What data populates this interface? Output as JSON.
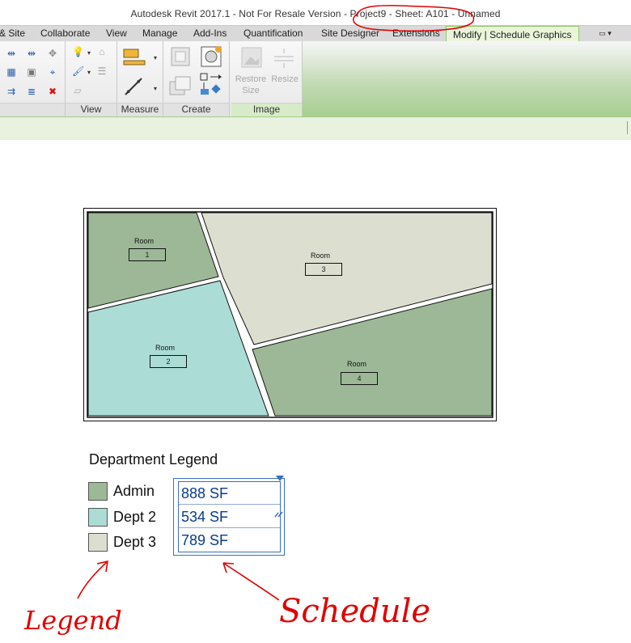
{
  "window": {
    "title": "Autodesk Revit 2017.1 - Not For Resale Version -    Project9 - Sheet: A101 - Unnamed"
  },
  "ribbon_tabs": [
    {
      "label": "& Site"
    },
    {
      "label": "Collaborate"
    },
    {
      "label": "View"
    },
    {
      "label": "Manage"
    },
    {
      "label": "Add-Ins"
    },
    {
      "label": "Quantification"
    },
    {
      "label": "Site Designer"
    },
    {
      "label": "Extensions"
    },
    {
      "label": "Modify | Schedule Graphics"
    }
  ],
  "ribbon_panels": {
    "view": "View",
    "measure": "Measure",
    "create": "Create",
    "image": "Image",
    "restore_size": "Restore Size",
    "resize": "Resize"
  },
  "plan": {
    "rooms": [
      {
        "name": "Room",
        "number": "1",
        "color": "#9cb896"
      },
      {
        "name": "Room",
        "number": "2",
        "color": "#acdcd6"
      },
      {
        "name": "Room",
        "number": "3",
        "color": "#dcdfd0"
      },
      {
        "name": "Room",
        "number": "4",
        "color": "#9cb896"
      }
    ]
  },
  "legend": {
    "title": "Department Legend",
    "items": [
      {
        "label": "Admin",
        "color": "#9cb896"
      },
      {
        "label": "Dept 2",
        "color": "#acdcd6"
      },
      {
        "label": "Dept 3",
        "color": "#dcdfd0"
      }
    ]
  },
  "schedule": {
    "rows": [
      "888 SF",
      "534 SF",
      "789 SF"
    ]
  },
  "annotations": {
    "legend_note": "Legend",
    "schedule_note": "Schedule"
  },
  "colors": {
    "ribbon_active_tab": "#eaf4da",
    "selection_blue": "#3a6fc4",
    "annotation_red": "#e00000"
  }
}
